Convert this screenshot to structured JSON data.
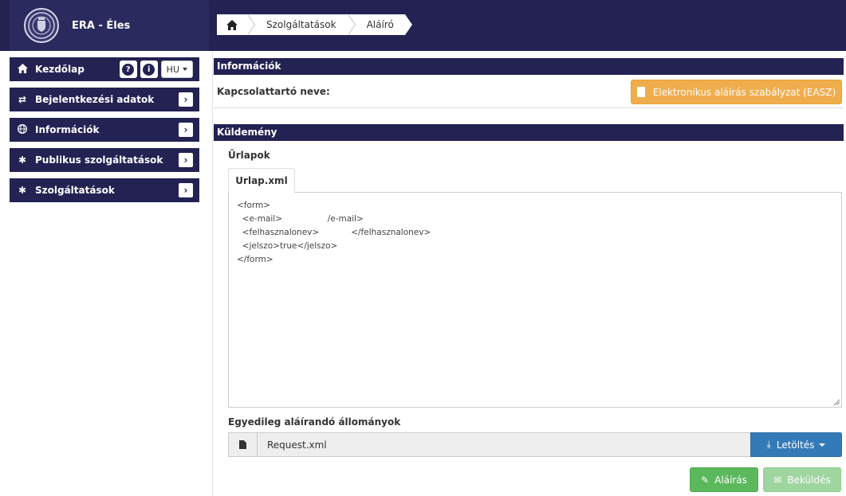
{
  "header": {
    "app_title": "ERA - Éles",
    "logo_icon": "coat-of-arms-seal",
    "breadcrumb": [
      {
        "label": "",
        "icon": "home-icon"
      },
      {
        "label": "Szolgáltatások"
      },
      {
        "label": "Aláíró"
      }
    ]
  },
  "sidebar": {
    "home": {
      "label": "Kezdőlap",
      "lang": "HU"
    },
    "items": [
      {
        "label": "Bejelentkezési adatok",
        "icon": "swap-icon"
      },
      {
        "label": "Információk",
        "icon": "globe-icon"
      },
      {
        "label": "Publikus szolgáltatások",
        "icon": "gear-icon"
      },
      {
        "label": "Szolgáltatások",
        "icon": "gear-icon"
      }
    ]
  },
  "info_panel": {
    "title": "Információk",
    "contact_label": "Kapcsolattartó neve:",
    "easz_button": "Elektronikus aláírás szabályzat (EASZ)"
  },
  "shipment_panel": {
    "title": "Küldemény",
    "forms_title": "Űrlapok",
    "tab_label": "Urlap.xml",
    "xml_lines": [
      "<form>",
      "  <e-mail>                 /e-mail>",
      "  <felhasznalonev>            </felhasznalonev>",
      "  <jelszo>true</jelszo>",
      "</form>"
    ],
    "files_title": "Egyedileg aláírandó állományok",
    "file_name": "Request.xml",
    "download_button": "Letöltés",
    "sign_button": "Aláírás",
    "send_button": "Beküldés"
  },
  "colors": {
    "navy": "#232253",
    "warning": "#f0ad4e",
    "primary": "#337ab7",
    "success": "#5cb85c",
    "success_disabled": "#9fd69f"
  }
}
